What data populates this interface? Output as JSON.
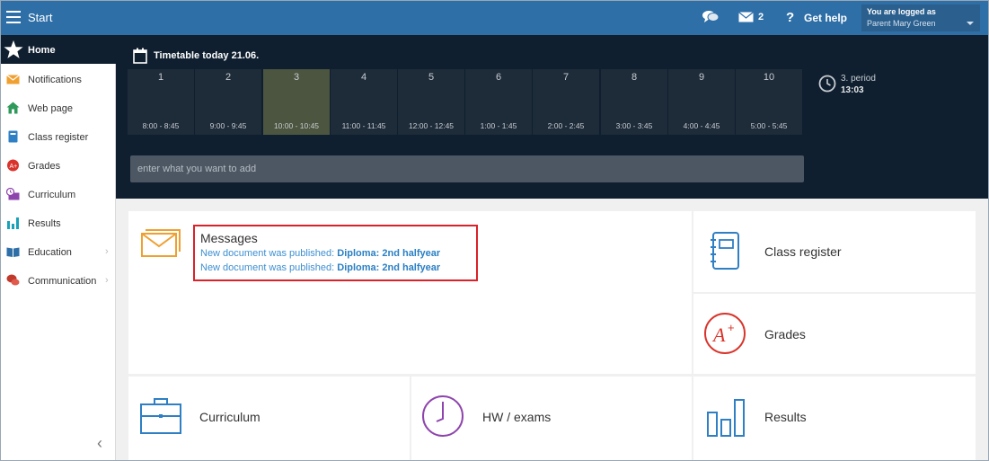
{
  "topbar": {
    "title": "Start",
    "unread_messages": "2",
    "help_label": "Get help",
    "logged_as_label": "You are logged as",
    "user_name": "Parent Mary Green"
  },
  "sidebar": {
    "home_label": "Home",
    "items": [
      {
        "label": "Notifications",
        "icon": "envelope-icon",
        "color": "#f0a030"
      },
      {
        "label": "Web page",
        "icon": "house-icon",
        "color": "#2e9a5a"
      },
      {
        "label": "Class register",
        "icon": "book-icon",
        "color": "#2e7fc4"
      },
      {
        "label": "Grades",
        "icon": "grade-badge-icon",
        "color": "#d9342b"
      },
      {
        "label": "Curriculum",
        "icon": "clock-board-icon",
        "color": "#8e44ad"
      },
      {
        "label": "Results",
        "icon": "bar-chart-icon",
        "color": "#17a2b8"
      },
      {
        "label": "Education",
        "icon": "open-book-icon",
        "color": "#2e6fa8"
      },
      {
        "label": "Communication",
        "icon": "speech-bubbles-icon",
        "color": "#c0392b"
      }
    ]
  },
  "timetable": {
    "title": "Timetable today 21.06.",
    "periods": [
      {
        "num": "1",
        "time": "8:00 - 8:45"
      },
      {
        "num": "2",
        "time": "9:00 - 9:45"
      },
      {
        "num": "3",
        "time": "10:00 - 10:45"
      },
      {
        "num": "4",
        "time": "11:00 - 11:45"
      },
      {
        "num": "5",
        "time": "12:00 - 12:45"
      },
      {
        "num": "6",
        "time": "1:00 - 1:45"
      },
      {
        "num": "7",
        "time": "2:00 - 2:45"
      },
      {
        "num": "8",
        "time": "3:00 - 3:45"
      },
      {
        "num": "9",
        "time": "4:00 - 4:45"
      },
      {
        "num": "10",
        "time": "5:00 - 5:45"
      }
    ],
    "active_period": 3,
    "current_period": "3. period",
    "current_time": "13:03",
    "add_placeholder": "enter what you want to add"
  },
  "messages": {
    "title": "Messages",
    "items": [
      {
        "prefix": "New document was published: ",
        "link": "Diploma: 2nd halfyear"
      },
      {
        "prefix": "New document was published: ",
        "link": "Diploma: 2nd halfyear"
      }
    ]
  },
  "tiles": {
    "class_register": "Class register",
    "grades": "Grades",
    "curriculum": "Curriculum",
    "hw_exams": "HW / exams",
    "results": "Results"
  },
  "colors": {
    "topbar": "#2e6fa8",
    "dark": "#0f1f2f",
    "active_period": "#4c5540",
    "highlight_border": "#d9222a"
  }
}
